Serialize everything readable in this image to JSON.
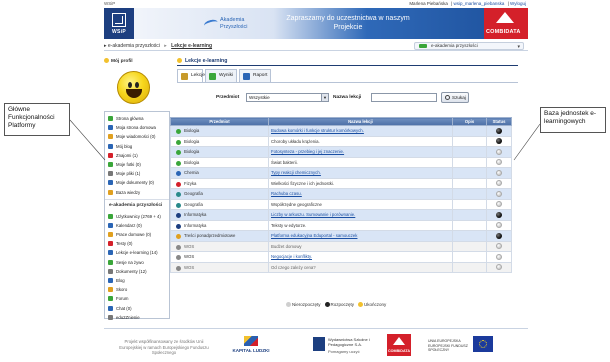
{
  "top": {
    "brand": "WSiP",
    "user_name": "Marlena Piebańska",
    "user_login": "wsip_marlena_piebanska",
    "logout": "Wyloguj",
    "separator": "|"
  },
  "banner": {
    "wsip": "WSiP",
    "akademia_line1": "Akademia",
    "akademia_line2": "Przyszłości",
    "slogan": "Zapraszamy do uczestnictwa w naszym Projekcie",
    "partner": "COMBIDATA"
  },
  "nav": {
    "crumb1": "e-akademia przyszłości",
    "crumb2": "Lekcje e-learning",
    "select_value": "e-akademia przyszłości"
  },
  "sidebar": {
    "profile_label": "Mój profil",
    "items": [
      {
        "label": "Strona główna",
        "color": "#3aa63a"
      },
      {
        "label": "Moja strona domowa",
        "color": "#2a65b5"
      },
      {
        "label": "Moje wiadomości (0)",
        "color": "#e0a020"
      },
      {
        "label": "Mój blog",
        "color": "#2a65b5"
      },
      {
        "label": "Znajomi (1)",
        "color": "#d4202a"
      },
      {
        "label": "Moje fotki (0)",
        "color": "#3aa63a"
      },
      {
        "label": "Moje pliki (1)",
        "color": "#777777"
      },
      {
        "label": "Moje dokumenty (0)",
        "color": "#2a65b5"
      },
      {
        "label": "Baza wiedzy",
        "color": "#e0a020"
      }
    ],
    "section_title": "e-akademia przyszłości",
    "section_items": [
      {
        "label": "Użytkownicy (2769 + 4)",
        "color": "#3aa63a"
      },
      {
        "label": "Kalendarz (0)",
        "color": "#2a65b5"
      },
      {
        "label": "Prace domowe (0)",
        "color": "#e0a020"
      },
      {
        "label": "Testy (0)",
        "color": "#d4202a"
      },
      {
        "label": "Lekcje e-learning (14)",
        "color": "#2a65b5"
      },
      {
        "label": "Sesje na żywo",
        "color": "#3aa63a"
      },
      {
        "label": "Dokumenty (12)",
        "color": "#777777"
      },
      {
        "label": "Blog",
        "color": "#2a65b5"
      },
      {
        "label": "Skoro",
        "color": "#e0a020"
      },
      {
        "label": "Forum",
        "color": "#3aa63a"
      },
      {
        "label": "Chat (0)",
        "color": "#2a65b5"
      },
      {
        "label": "edu2Znienie",
        "color": "#777777"
      }
    ]
  },
  "main": {
    "title": "Lekcje e-learning",
    "tabs": [
      {
        "label": "Lekcje",
        "color": "#c79a2a"
      },
      {
        "label": "Wyniki",
        "color": "#3aa63a"
      },
      {
        "label": "Raport",
        "color": "#2a65b5"
      }
    ],
    "filter": {
      "subject_label": "Przedmiot",
      "subject_value": "Wszystkie",
      "name_label": "Nazwa lekcji",
      "search_button": "Szukaj"
    },
    "table": {
      "headers": [
        "Przedmiot",
        "Nazwa lekcji",
        "Opis",
        "Status"
      ],
      "rows": [
        {
          "subject": "Biologia",
          "topic": "Budowa komórki i funkcje struktur komórkowych.",
          "style": "blue",
          "link": true,
          "status": "black",
          "dot": "#3aa63a"
        },
        {
          "subject": "Biologia",
          "topic": "Choroby układu krążenia.",
          "style": "white",
          "link": false,
          "status": "black",
          "dot": "#3aa63a"
        },
        {
          "subject": "Biologia",
          "topic": "Fotosynteza - przebieg i jej znaczenie.",
          "style": "blue",
          "link": true,
          "status": "grey",
          "dot": "#3aa63a"
        },
        {
          "subject": "Biologia",
          "topic": "Świat bakterii.",
          "style": "white",
          "link": false,
          "status": "grey",
          "dot": "#3aa63a"
        },
        {
          "subject": "Chemia",
          "topic": "Typy reakcji chemicznych.",
          "style": "blue",
          "link": true,
          "status": "grey",
          "dot": "#2a65b5"
        },
        {
          "subject": "Fizyka",
          "topic": "Wielkości fizyczne i ich jednostki.",
          "style": "white",
          "link": false,
          "status": "grey",
          "dot": "#d4202a"
        },
        {
          "subject": "Geografia",
          "topic": "Rachuba czasu.",
          "style": "blue",
          "link": true,
          "status": "grey",
          "dot": "#2a8a8a"
        },
        {
          "subject": "Geografia",
          "topic": "Współrzędne geograficzne",
          "style": "white",
          "link": false,
          "status": "grey",
          "dot": "#2a8a8a"
        },
        {
          "subject": "Informatyka",
          "topic": "Liczby w arkuszu. Sumowanie i porównanie.",
          "style": "blue",
          "link": true,
          "status": "black",
          "dot": "#1d3f80"
        },
        {
          "subject": "Informatyka",
          "topic": "Teksty w edytorze.",
          "style": "white",
          "link": false,
          "status": "grey",
          "dot": "#1d3f80"
        },
        {
          "subject": "Treści ponadprzedmiotowe",
          "topic": "Platforma edukacyjna Eduportal - samouczek",
          "style": "blue",
          "link": true,
          "status": "black",
          "dot": "#e0a020"
        },
        {
          "subject": "WOS",
          "topic": "Budżet domowy",
          "style": "dim",
          "link": false,
          "status": "grey",
          "dot": "#888888"
        },
        {
          "subject": "WOS",
          "topic": "Negocjacje i konflikty.",
          "style": "white",
          "link": true,
          "status": "grey",
          "dot": "#888888"
        },
        {
          "subject": "WOS",
          "topic": "Od czego zależy cena?",
          "style": "dim",
          "link": false,
          "status": "grey",
          "dot": "#888888"
        }
      ]
    },
    "legend": [
      {
        "label": "Nierozpoczęty",
        "color": "#cfcfcf"
      },
      {
        "label": "Rozpoczęty",
        "color": "#222222"
      },
      {
        "label": "Ukończony",
        "color": "#f2c12e"
      }
    ]
  },
  "callouts": {
    "left": "Główne Funkcjonalności Platformy",
    "right": "Baza jednostek e-learningowych"
  },
  "footer": {
    "text": "Projekt współfinansowany ze środków Unii Europejskiej w ramach Europejskiego Funduszu Społecznego",
    "kapital": "KAPITAŁ LUDZKI",
    "wsip_full": "Wydawnictwa Szkolne i Pedagogiczne S.A.",
    "wsip_tag": "Pomagamy uczyć",
    "combidata": "COMBIDATA",
    "ue": "UNIA EUROPEJSKA EUROPEJSKI FUNDUSZ SPOŁECZNY"
  }
}
